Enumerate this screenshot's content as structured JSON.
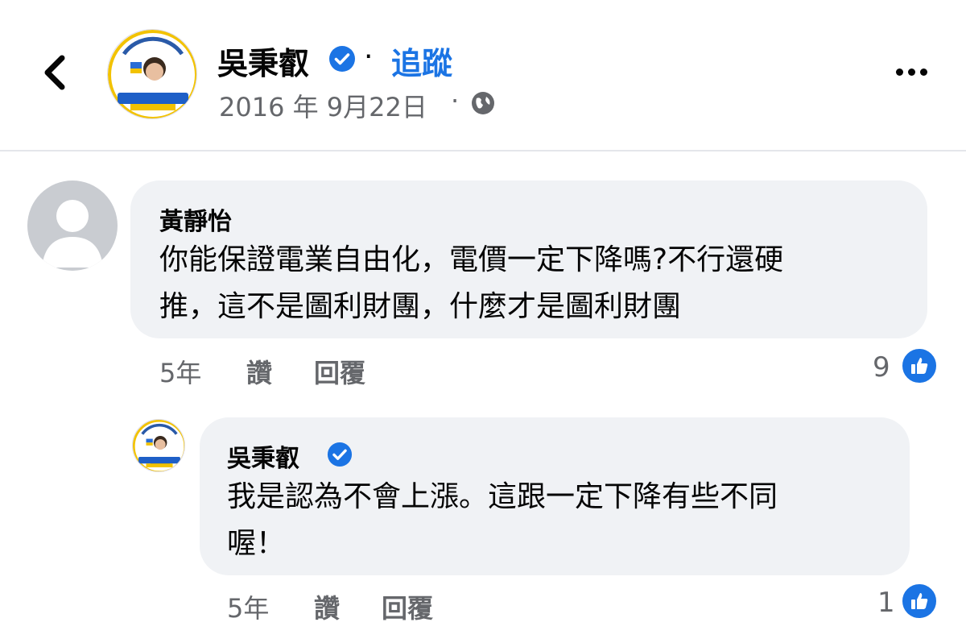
{
  "header": {
    "author_name": "吳秉叡",
    "dot": "·",
    "follow_label": "追蹤",
    "date": "2016 年 9月22日",
    "date_dot": "·"
  },
  "comments": [
    {
      "name": "黃靜怡",
      "text": "你能保證電業自由化，電價一定下降嗎?不行還硬\n推，這不是圖利財團，什麼才是圖利財團",
      "time": "5年",
      "like_label": "讚",
      "reply_label": "回覆",
      "likes": "9"
    },
    {
      "name": "吳秉叡",
      "text": "我是認為不會上漲。這跟一定下降有些不同\n喔！",
      "time": "5年",
      "like_label": "讚",
      "reply_label": "回覆",
      "likes": "1"
    }
  ],
  "colors": {
    "accent": "#1b74e4",
    "bubble": "#f0f2f5",
    "muted": "#65676b"
  },
  "icons": [
    "back-chevron-icon",
    "verified-badge-icon",
    "globe-icon",
    "more-dots-icon",
    "like-thumb-icon"
  ]
}
